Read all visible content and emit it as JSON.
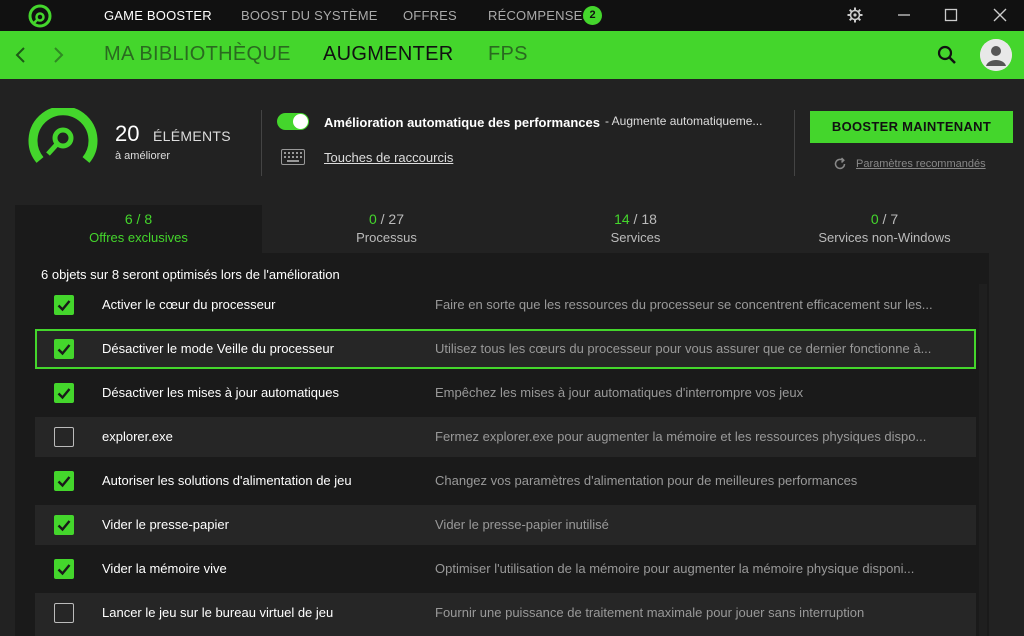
{
  "titlebar": {
    "tabs": [
      {
        "label": "GAME BOOSTER",
        "active": true
      },
      {
        "label": "BOOST DU SYSTÈME",
        "active": false
      },
      {
        "label": "OFFRES",
        "active": false
      },
      {
        "label": "RÉCOMPENSES",
        "active": false
      }
    ],
    "rewards_badge": "2",
    "icons": [
      "app-logo-icon",
      "settings-icon",
      "minimize-icon",
      "maximize-icon",
      "close-icon"
    ]
  },
  "navbar": {
    "items": [
      {
        "label": "MA BIBLIOTHÈQUE",
        "active": false
      },
      {
        "label": "AUGMENTER",
        "active": true
      },
      {
        "label": "FPS",
        "active": false
      }
    ],
    "icons": [
      "back-arrow-icon",
      "forward-arrow-icon",
      "search-icon",
      "avatar-icon"
    ]
  },
  "header": {
    "count": "20",
    "count_label": "ÉLÉMENTS",
    "count_sub": "à améliorer",
    "auto_boost_title": "Amélioration automatique des performances",
    "auto_boost_desc": "- Augmente automatiqueme...",
    "auto_boost_enabled": true,
    "shortcuts_link": "Touches de raccourcis",
    "boost_button": "BOOSTER MAINTENANT",
    "recommended_link": "Paramètres recommandés"
  },
  "tabs": [
    {
      "done": "6",
      "total": "/ 8",
      "label": "Offres exclusives",
      "active": true
    },
    {
      "done": "0",
      "total": "/ 27",
      "label": "Processus",
      "active": false
    },
    {
      "done": "14",
      "total": "/ 18",
      "label": "Services",
      "active": false
    },
    {
      "done": "0",
      "total": "/ 7",
      "label": "Services non-Windows",
      "active": false
    }
  ],
  "summary": "6 objets sur 8 seront optimisés lors de l'amélioration",
  "items": [
    {
      "title": "Activer le cœur du processeur",
      "desc": "Faire en sorte que les ressources du processeur se concentrent efficacement sur les...",
      "checked": true
    },
    {
      "title": "Désactiver le mode Veille du processeur",
      "desc": "Utilisez tous les cœurs du processeur pour vous assurer que ce dernier fonctionne à...",
      "checked": true
    },
    {
      "title": "Désactiver les mises à jour automatiques",
      "desc": "Empêchez les mises à jour automatiques d'interrompre vos jeux",
      "checked": true
    },
    {
      "title": "explorer.exe",
      "desc": "Fermez explorer.exe pour augmenter la mémoire et les ressources physiques dispo...",
      "checked": false
    },
    {
      "title": "Autoriser les solutions d'alimentation de jeu",
      "desc": "Changez vos paramètres d'alimentation pour de meilleures performances",
      "checked": true
    },
    {
      "title": "Vider le presse-papier",
      "desc": "Vider le presse-papier inutilisé",
      "checked": true
    },
    {
      "title": "Vider la mémoire vive",
      "desc": "Optimiser l'utilisation de la mémoire pour augmenter la mémoire physique disponi...",
      "checked": true
    },
    {
      "title": "Lancer le jeu sur le bureau virtuel de jeu",
      "desc": "Fournir une puissance de traitement maximale pour jouer sans interruption",
      "checked": false
    }
  ],
  "colors": {
    "accent": "#44d62c",
    "background": "#222222",
    "panel": "#1a1a1a",
    "titlebar": "#111111"
  }
}
